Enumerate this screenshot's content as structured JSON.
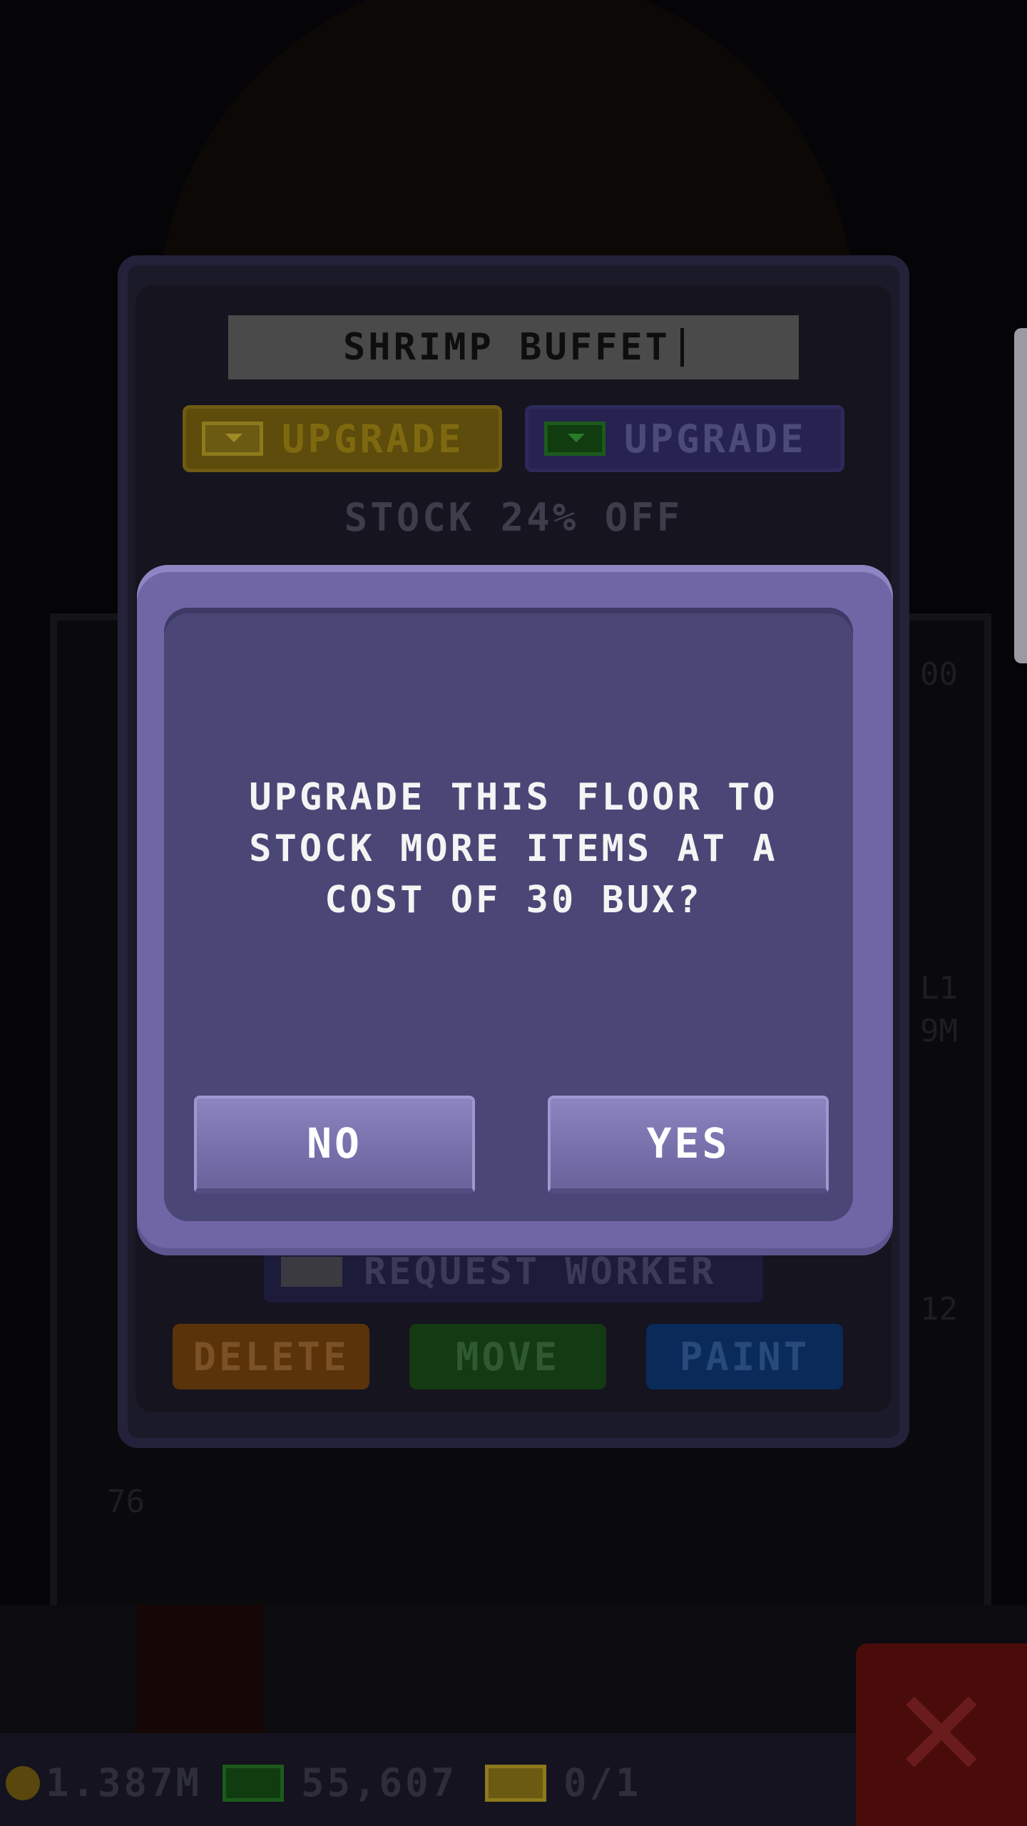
{
  "floor": {
    "name": "SHRIMP BUFFET",
    "upgrade_gold_label": "UPGRADE",
    "upgrade_bux_label": "UPGRADE",
    "discount_text": "STOCK 24% OFF",
    "request_worker_label": "REQUEST WORKER",
    "delete_label": "DELETE",
    "move_label": "MOVE",
    "paint_label": "PAINT"
  },
  "dialog": {
    "message": "UPGRADE THIS FLOOR TO STOCK MORE ITEMS AT A COST OF 30 BUX?",
    "no_label": "NO",
    "yes_label": "YES"
  },
  "status": {
    "coins": "1.387M",
    "bux": "55,607",
    "tickets": "0/1"
  },
  "background": {
    "frag1": "00",
    "frag2": "L1",
    "frag3": "9M",
    "frag4": "12",
    "frag5": "76",
    "frag6": "12"
  },
  "colors": {
    "modal": "#7066a6",
    "modal_inner": "#4a4676",
    "button": "#7570aa"
  }
}
